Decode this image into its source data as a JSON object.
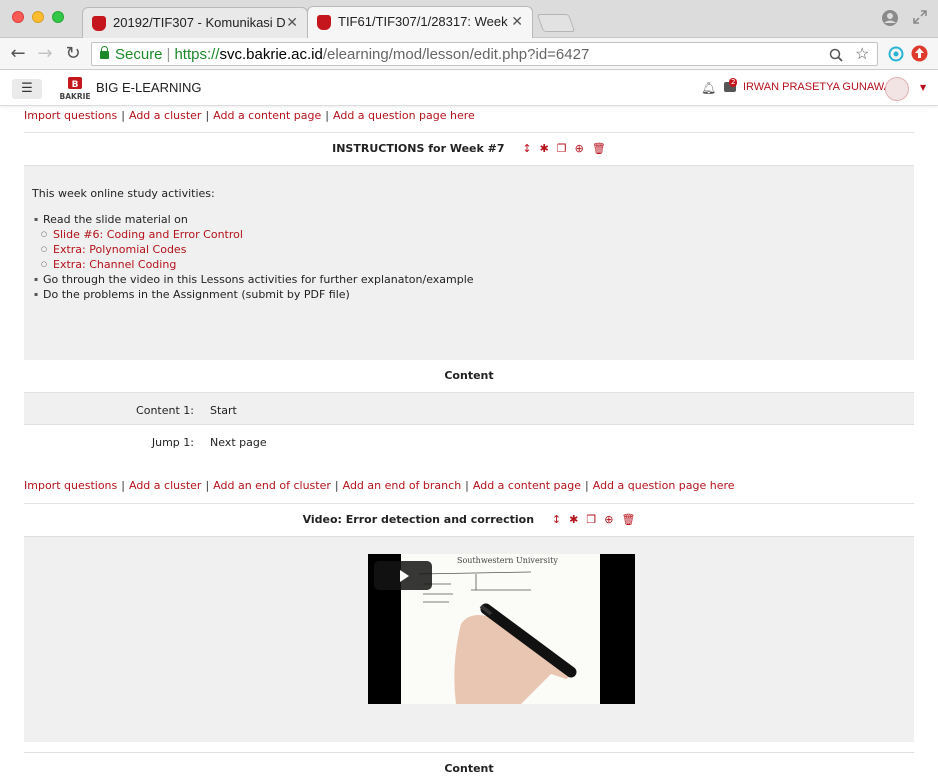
{
  "browser": {
    "tabs": [
      {
        "title": "20192/TIF307 - Komunikasi D",
        "active": false
      },
      {
        "title": "TIF61/TIF307/1/28317: Week",
        "active": true
      }
    ],
    "url": {
      "secure_label": "Secure",
      "scheme": "https://",
      "host": "svc.bakrie.ac.id",
      "path": "/elearning/mod/lesson/edit.php?id=6427"
    }
  },
  "navbar": {
    "brand": "BIG E-LEARNING",
    "logo_text": "BAKRIE",
    "notification_count": "2",
    "username": "IRWAN PRASETYA GUNAWAN"
  },
  "colors": {
    "accent": "#b5121b",
    "panel": "#f0f0f0",
    "secure": "#1d8a2a"
  },
  "top_links": [
    "Import questions",
    "Add a cluster",
    "Add a content page",
    "Add a question page here"
  ],
  "page1": {
    "title": "INSTRUCTIONS for Week #7",
    "intro": "This week online study activities:",
    "bullets": [
      {
        "text": "Read the slide material on",
        "sub": [
          "Slide #6: Coding and Error Control",
          "Extra: Polynomial Codes",
          "Extra: Channel Coding"
        ]
      },
      {
        "text": "Go through the video in this Lessons activities for further explanaton/example"
      },
      {
        "text": "Do the problems in the Assignment (submit by PDF file)"
      }
    ],
    "content_heading": "Content",
    "rows": [
      {
        "label": "Content 1:",
        "value": "Start"
      },
      {
        "label": "Jump 1:",
        "value": "Next page"
      }
    ]
  },
  "mid_links": [
    "Import questions",
    "Add a cluster",
    "Add an end of cluster",
    "Add an end of branch",
    "Add a content page",
    "Add a question page here"
  ],
  "page2": {
    "title": "Video: Error detection and correction",
    "video_caption": "Southwestern University",
    "content_heading": "Content"
  },
  "icons": {
    "move": "move-icon",
    "edit": "gear-icon",
    "copy": "copy-icon",
    "preview": "zoom-icon",
    "delete": "trash-icon"
  }
}
